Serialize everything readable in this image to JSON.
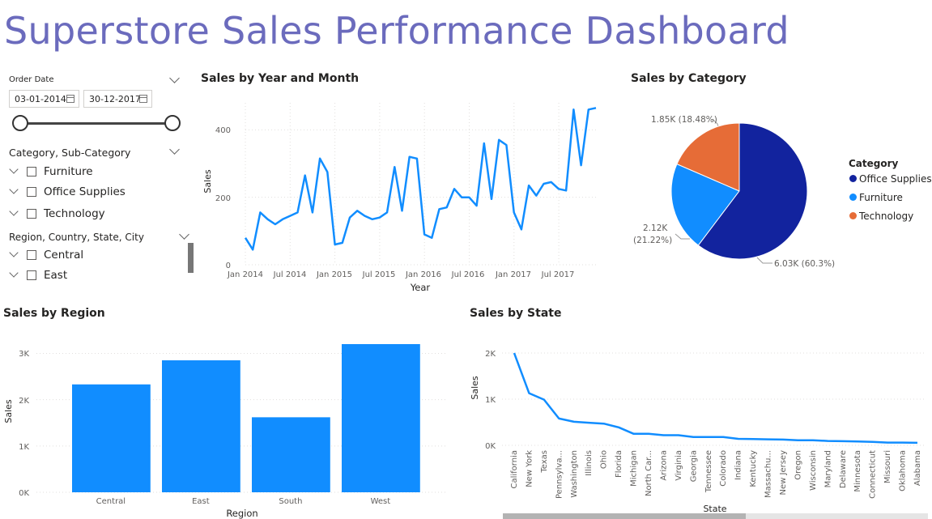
{
  "page": {
    "title": "Superstore Sales Performance Dashboard"
  },
  "slicers": {
    "order_date": {
      "label": "Order Date",
      "start": "03-01-2014",
      "end": "30-12-2017"
    },
    "category": {
      "label": "Category, Sub-Category",
      "items": [
        "Furniture",
        "Office Supplies",
        "Technology"
      ]
    },
    "region": {
      "label": "Region, Country, State, City",
      "items": [
        "Central",
        "East"
      ]
    }
  },
  "line_chart": {
    "title": "Sales by Year and Month",
    "x_label": "Year",
    "y_label": "Sales",
    "y_ticks": [
      "0",
      "200",
      "400"
    ],
    "x_ticks": [
      "Jan 2014",
      "Jul 2014",
      "Jan 2015",
      "Jul 2015",
      "Jan 2016",
      "Jul 2016",
      "Jan 2017",
      "Jul 2017"
    ]
  },
  "pie_chart": {
    "title": "Sales by Category",
    "legend_title": "Category",
    "labels": [
      "6.03K (60.3%)",
      "2.12K",
      "(21.22%)",
      "1.85K (18.48%)"
    ]
  },
  "region_chart": {
    "title": "Sales by Region",
    "x_label": "Region",
    "y_label": "Sales",
    "y_ticks": [
      "0K",
      "1K",
      "2K",
      "3K"
    ]
  },
  "state_chart": {
    "title": "Sales by State",
    "x_label": "State",
    "y_label": "Sales",
    "y_ticks": [
      "0K",
      "1K",
      "2K"
    ]
  },
  "chart_data": [
    {
      "type": "line",
      "title": "Sales by Year and Month",
      "xlabel": "Year",
      "ylabel": "Sales",
      "ylim": [
        0,
        480
      ],
      "x_range": [
        "2014-01",
        "2017-12"
      ],
      "x": [
        "2014-01",
        "2014-02",
        "2014-03",
        "2014-04",
        "2014-05",
        "2014-06",
        "2014-07",
        "2014-08",
        "2014-09",
        "2014-10",
        "2014-11",
        "2014-12",
        "2015-01",
        "2015-02",
        "2015-03",
        "2015-04",
        "2015-05",
        "2015-06",
        "2015-07",
        "2015-08",
        "2015-09",
        "2015-10",
        "2015-11",
        "2015-12",
        "2016-01",
        "2016-02",
        "2016-03",
        "2016-04",
        "2016-05",
        "2016-06",
        "2016-07",
        "2016-08",
        "2016-09",
        "2016-10",
        "2016-11",
        "2016-12",
        "2017-01",
        "2017-02",
        "2017-03",
        "2017-04",
        "2017-05",
        "2017-06",
        "2017-07",
        "2017-08",
        "2017-09",
        "2017-10",
        "2017-11",
        "2017-12"
      ],
      "values": [
        80,
        45,
        155,
        135,
        120,
        135,
        145,
        155,
        265,
        155,
        315,
        275,
        60,
        65,
        140,
        160,
        145,
        135,
        140,
        155,
        290,
        160,
        320,
        315,
        90,
        80,
        165,
        170,
        225,
        200,
        200,
        175,
        360,
        195,
        370,
        355,
        155,
        105,
        235,
        205,
        240,
        245,
        225,
        220,
        460,
        295,
        460,
        465
      ],
      "grid": true
    },
    {
      "type": "pie",
      "title": "Sales by Category",
      "legend": {
        "title": "Category",
        "position": "right"
      },
      "slices": [
        {
          "name": "Office Supplies",
          "value": 6030,
          "percent": 60.3,
          "color": "#12239e"
        },
        {
          "name": "Furniture",
          "value": 2120,
          "percent": 21.22,
          "color": "#118dff"
        },
        {
          "name": "Technology",
          "value": 1850,
          "percent": 18.48,
          "color": "#e66c37"
        }
      ]
    },
    {
      "type": "bar",
      "title": "Sales by Region",
      "xlabel": "Region",
      "ylabel": "Sales",
      "categories": [
        "Central",
        "East",
        "South",
        "West"
      ],
      "values": [
        2330,
        2850,
        1620,
        3200
      ],
      "ylim": [
        0,
        3200
      ],
      "color": "#118dff",
      "grid": true
    },
    {
      "type": "line",
      "title": "Sales by State",
      "xlabel": "State",
      "ylabel": "Sales",
      "categories": [
        "California",
        "New York",
        "Texas",
        "Pennsylva...",
        "Washington",
        "Illinois",
        "Ohio",
        "Florida",
        "Michigan",
        "North Car...",
        "Arizona",
        "Virginia",
        "Georgia",
        "Tennessee",
        "Colorado",
        "Indiana",
        "Kentucky",
        "Massachu...",
        "New Jersey",
        "Oregon",
        "Wisconsin",
        "Maryland",
        "Delaware",
        "Minnesota",
        "Connecticut",
        "Missouri",
        "Oklahoma",
        "Alabama"
      ],
      "values": [
        2000,
        1130,
        990,
        580,
        510,
        490,
        470,
        390,
        250,
        250,
        220,
        220,
        180,
        180,
        180,
        140,
        135,
        130,
        125,
        110,
        110,
        95,
        90,
        85,
        75,
        60,
        60,
        55
      ],
      "ylim": [
        0,
        2000
      ],
      "color": "#118dff",
      "grid": true
    }
  ],
  "colors": {
    "accent": "#118dff",
    "title": "#6b6bbd",
    "office_supplies": "#12239e",
    "furniture": "#118dff",
    "technology": "#e66c37"
  }
}
